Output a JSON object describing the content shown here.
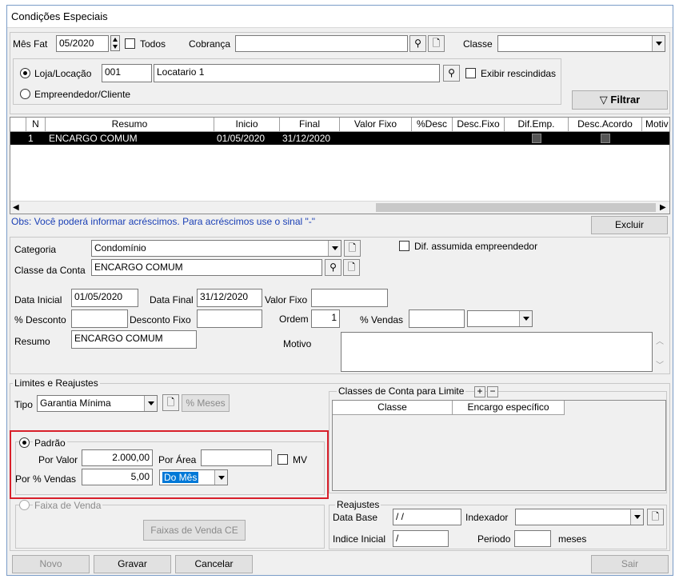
{
  "window": {
    "title": "Condições Especiais"
  },
  "top": {
    "mes_fat_label": "Mês Fat",
    "mes_fat_value": "05/2020",
    "todos_label": "Todos",
    "cobranca_label": "Cobrança",
    "cobranca_value": "",
    "classe_label": "Classe",
    "classe_value": "",
    "loja_locacao_label": "Loja/Locação",
    "loja_code": "001",
    "loja_name": "Locatario 1",
    "exibir_rescindidas_label": "Exibir rescindidas",
    "empreendedor_cliente_label": "Empreendedor/Cliente",
    "filtrar_label": "Filtrar"
  },
  "grid": {
    "columns": [
      "N",
      "Resumo",
      "Inicio",
      "Final",
      "Valor Fixo",
      "%Desc",
      "Desc.Fixo",
      "Dif.Emp.",
      "Desc.Acordo",
      "Motiv"
    ],
    "rows": [
      {
        "n": "1",
        "resumo": "ENCARGO COMUM",
        "inicio": "01/05/2020",
        "final": "31/12/2020",
        "valor_fixo": "",
        "desc": "",
        "desc_fixo": "",
        "motivo": ""
      }
    ]
  },
  "obs_text": "Obs: Você poderá informar acréscimos. Para acréscimos use o sinal \"-\"",
  "excluir_label": "Excluir",
  "detail": {
    "categoria_label": "Categoria",
    "categoria_value": "Condomínio",
    "dif_assumida_label": "Dif. assumida empreendedor",
    "classe_conta_label": "Classe da Conta",
    "classe_conta_value": "ENCARGO COMUM",
    "data_inicial_label": "Data Inicial",
    "data_inicial_value": "01/05/2020",
    "data_final_label": "Data Final",
    "data_final_value": "31/12/2020",
    "valor_fixo_label": "Valor Fixo",
    "valor_fixo_value": "",
    "pct_desconto_label": "% Desconto",
    "pct_desconto_value": "",
    "desconto_fixo_label": "Desconto Fixo",
    "desconto_fixo_value": "",
    "ordem_label": "Ordem",
    "ordem_value": "1",
    "pct_vendas_label": "% Vendas",
    "pct_vendas_value": "",
    "resumo_label": "Resumo",
    "resumo_value": "ENCARGO COMUM",
    "motivo_label": "Motivo",
    "motivo_value": ""
  },
  "limites": {
    "group_label": "Limites e Reajustes",
    "tipo_label": "Tipo",
    "tipo_value": "Garantia Mínima",
    "pct_meses_label": "% Meses",
    "padrao_label": "Padrão",
    "por_valor_label": "Por Valor",
    "por_valor_value": "2.000,00",
    "por_area_label": "Por Área",
    "por_area_value": "",
    "mv_label": "MV",
    "por_pct_vendas_label": "Por % Vendas",
    "por_pct_vendas_value": "5,00",
    "periodo_select_value": "Do Mês",
    "faixa_venda_label": "Faixa de Venda",
    "faixas_venda_ce_label": "Faixas de Venda CE",
    "classes_conta_label": "Classes de Conta para Limite",
    "classes_columns": [
      "Classe",
      "Encargo específico"
    ]
  },
  "reajustes": {
    "group_label": "Reajustes",
    "data_base_label": "Data Base",
    "data_base_value": " / /",
    "indexador_label": "Indexador",
    "indexador_value": "",
    "indice_inicial_label": "Indice Inicial",
    "indice_inicial_value": " /",
    "periodo_label": "Periodo",
    "periodo_value": "",
    "meses_label": "meses"
  },
  "footer": {
    "novo_label": "Novo",
    "gravar_label": "Gravar",
    "cancelar_label": "Cancelar",
    "sair_label": "Sair"
  },
  "colors": {
    "highlight": "#d81f2a",
    "selection": "#0078d7",
    "row_selected": "#000000"
  }
}
